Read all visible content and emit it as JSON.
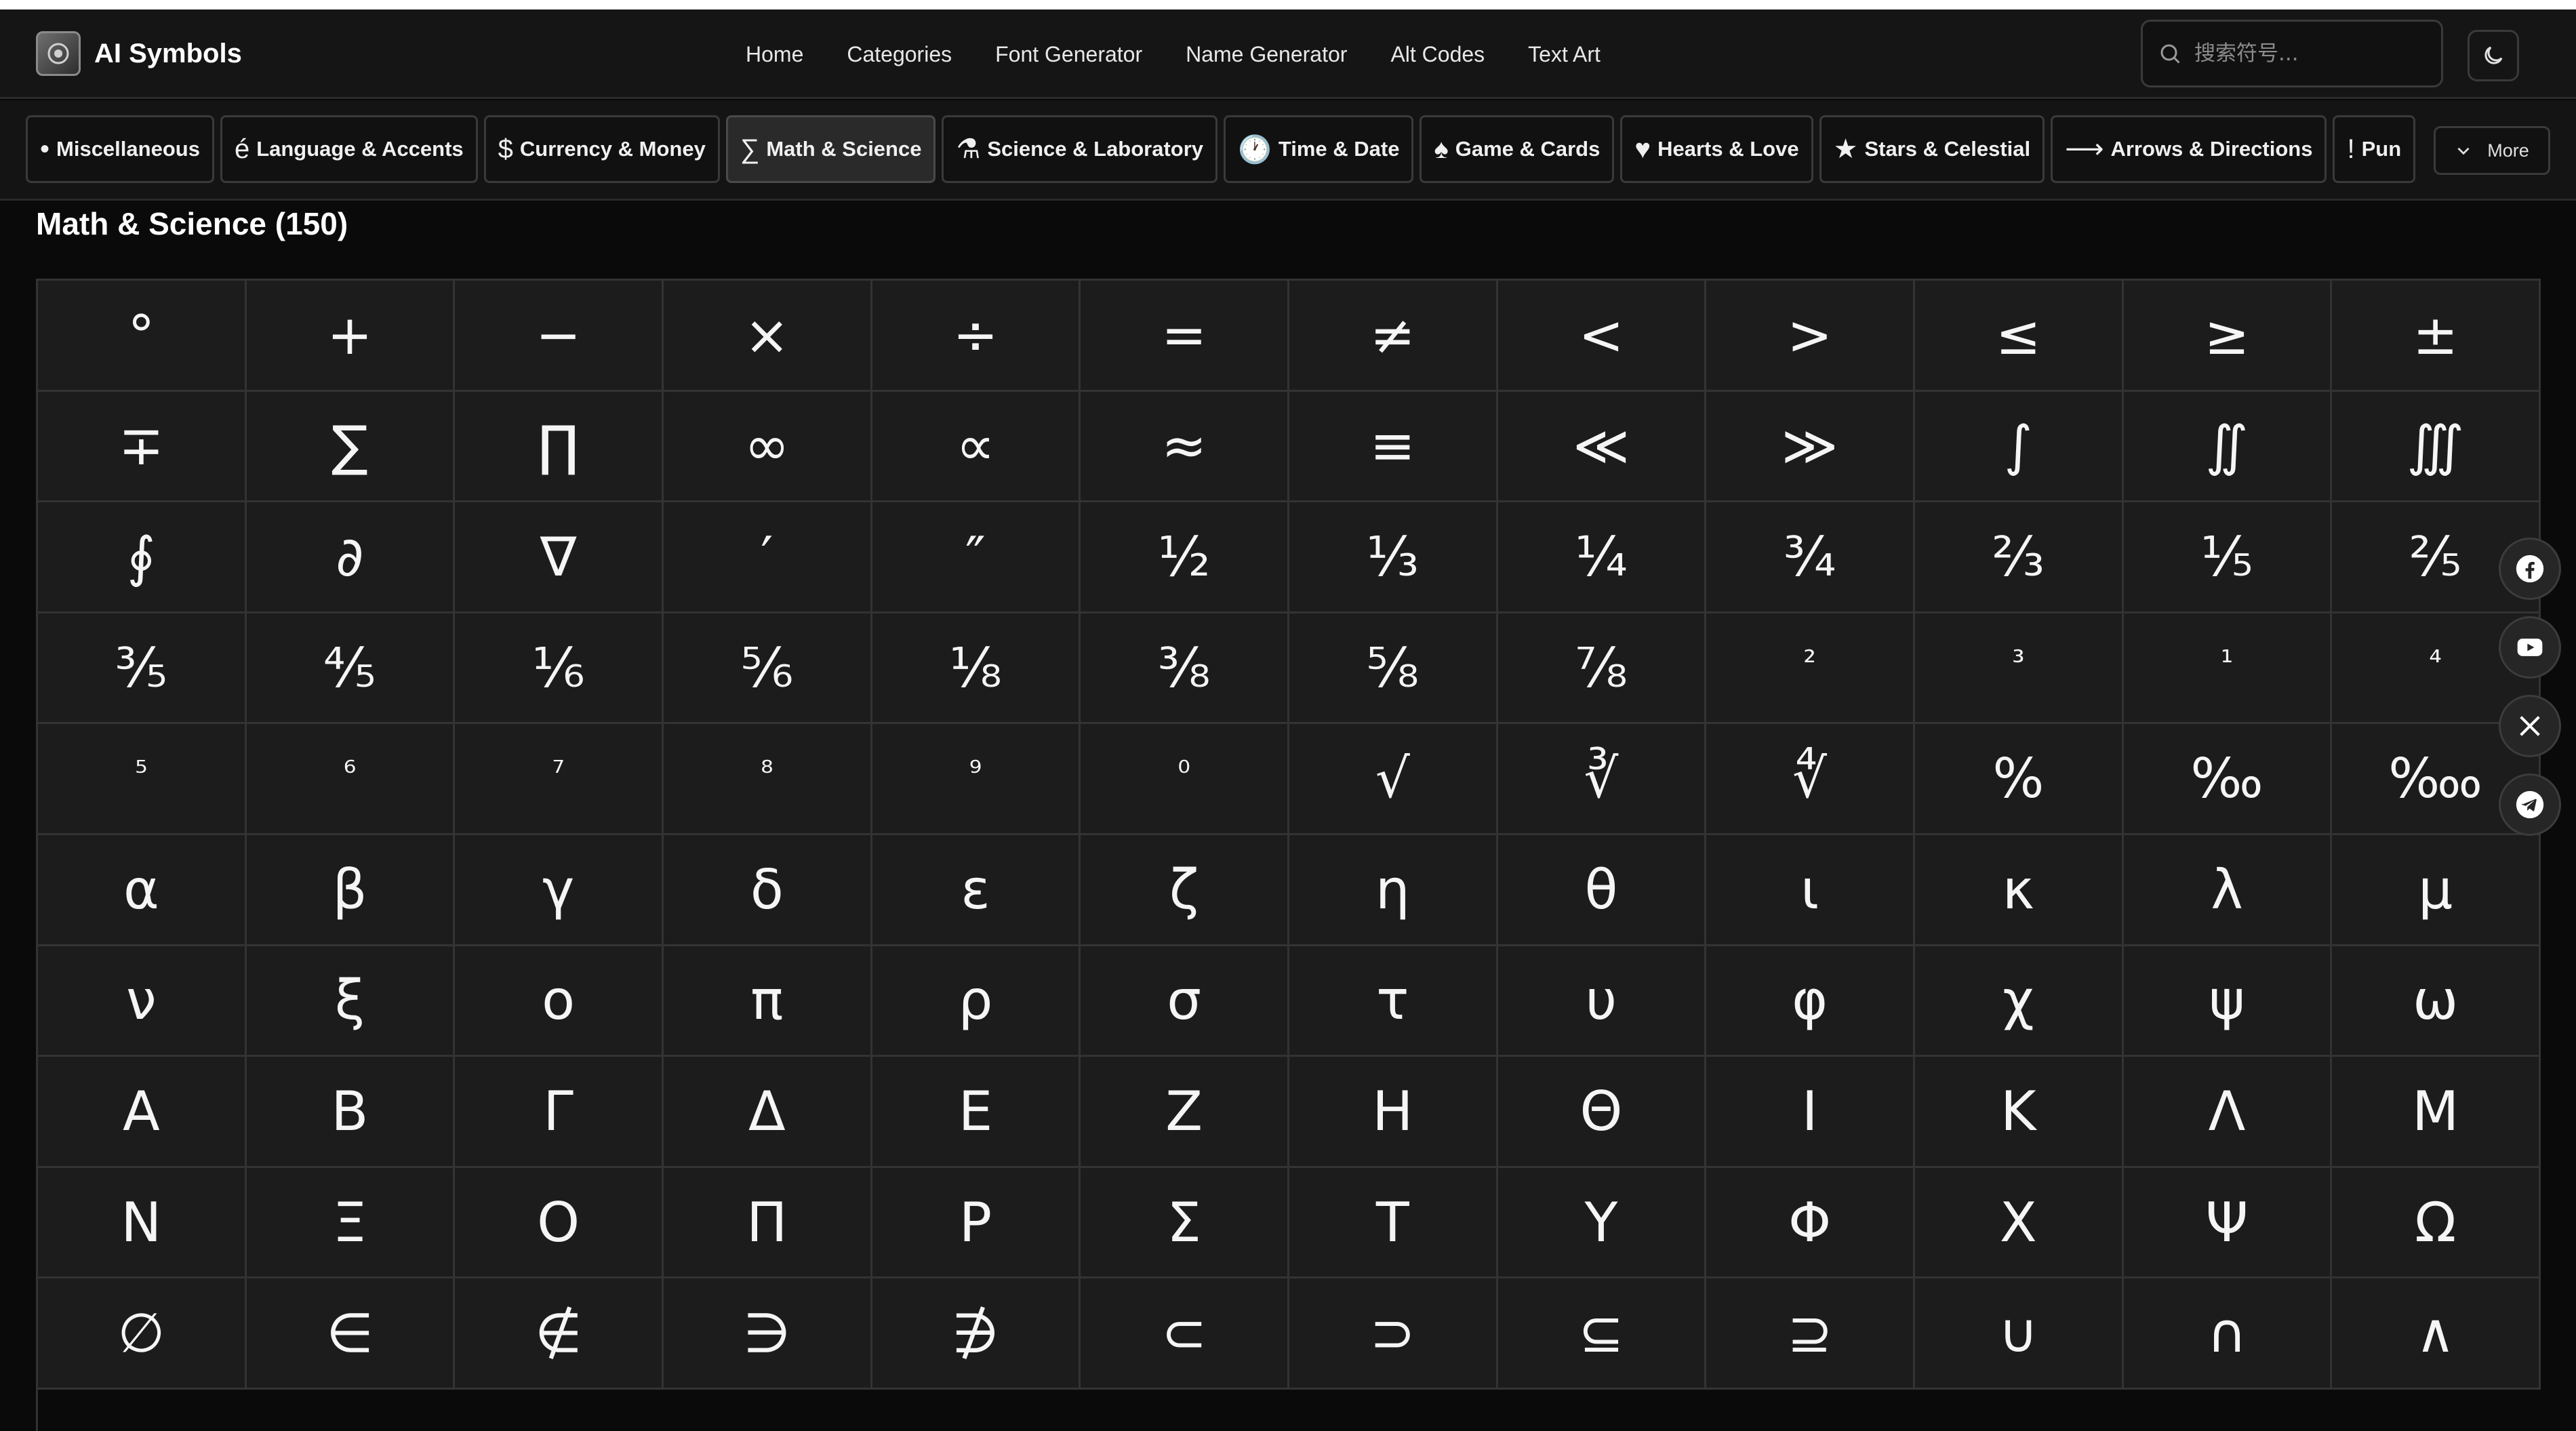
{
  "brand": {
    "name": "AI Symbols",
    "logo_icon": "logo-icon"
  },
  "nav": [
    "Home",
    "Categories",
    "Font Generator",
    "Name Generator",
    "Alt Codes",
    "Text Art"
  ],
  "search": {
    "placeholder": "搜索符号...",
    "icon": "search-icon"
  },
  "theme_toggle": {
    "icon": "moon-icon"
  },
  "categories": [
    {
      "icon": "•",
      "label": "Miscellaneous"
    },
    {
      "icon": "é",
      "label": "Language & Accents"
    },
    {
      "icon": "$",
      "label": "Currency & Money"
    },
    {
      "icon": "∑",
      "label": "Math & Science",
      "active": true
    },
    {
      "icon": "⚗",
      "label": "Science & Laboratory"
    },
    {
      "icon": "🕐",
      "label": "Time & Date"
    },
    {
      "icon": "♠",
      "label": "Game & Cards"
    },
    {
      "icon": "♥",
      "label": "Hearts & Love"
    },
    {
      "icon": "★",
      "label": "Stars & Celestial"
    },
    {
      "icon": "⟶",
      "label": "Arrows & Directions"
    },
    {
      "icon": "!",
      "label": "Pun"
    }
  ],
  "more_button": {
    "label": "More",
    "icon": "chevron-down-icon"
  },
  "section": {
    "title": "Math & Science (150)"
  },
  "symbols": [
    "°",
    "+",
    "−",
    "×",
    "÷",
    "=",
    "≠",
    "<",
    ">",
    "≤",
    "≥",
    "±",
    "∓",
    "∑",
    "∏",
    "∞",
    "∝",
    "≈",
    "≡",
    "≪",
    "≫",
    "∫",
    "∬",
    "∭",
    "∮",
    "∂",
    "∇",
    "′",
    "″",
    "½",
    "⅓",
    "¼",
    "¾",
    "⅔",
    "⅕",
    "⅖",
    "⅗",
    "⅘",
    "⅙",
    "⅚",
    "⅛",
    "⅜",
    "⅝",
    "⅞",
    "²",
    "³",
    "¹",
    "⁴",
    "⁵",
    "⁶",
    "⁷",
    "⁸",
    "⁹",
    "⁰",
    "√",
    "∛",
    "∜",
    "%",
    "‰",
    "‱",
    "α",
    "β",
    "γ",
    "δ",
    "ε",
    "ζ",
    "η",
    "θ",
    "ι",
    "κ",
    "λ",
    "μ",
    "ν",
    "ξ",
    "ο",
    "π",
    "ρ",
    "σ",
    "τ",
    "υ",
    "φ",
    "χ",
    "ψ",
    "ω",
    "Α",
    "Β",
    "Γ",
    "Δ",
    "Ε",
    "Ζ",
    "Η",
    "Θ",
    "Ι",
    "Κ",
    "Λ",
    "Μ",
    "Ν",
    "Ξ",
    "Ο",
    "Π",
    "Ρ",
    "Σ",
    "Τ",
    "Υ",
    "Φ",
    "Χ",
    "Ψ",
    "Ω",
    "∅",
    "∈",
    "∉",
    "∋",
    "∌",
    "⊂",
    "⊃",
    "⊆",
    "⊇",
    "∪",
    "∩",
    "∧"
  ],
  "small_symbols": [
    "²",
    "³",
    "¹",
    "⁴",
    "⁵",
    "⁶",
    "⁷",
    "⁸",
    "⁹",
    "⁰"
  ],
  "social": [
    {
      "name": "facebook-icon"
    },
    {
      "name": "youtube-icon"
    },
    {
      "name": "x-icon"
    },
    {
      "name": "telegram-icon"
    }
  ]
}
